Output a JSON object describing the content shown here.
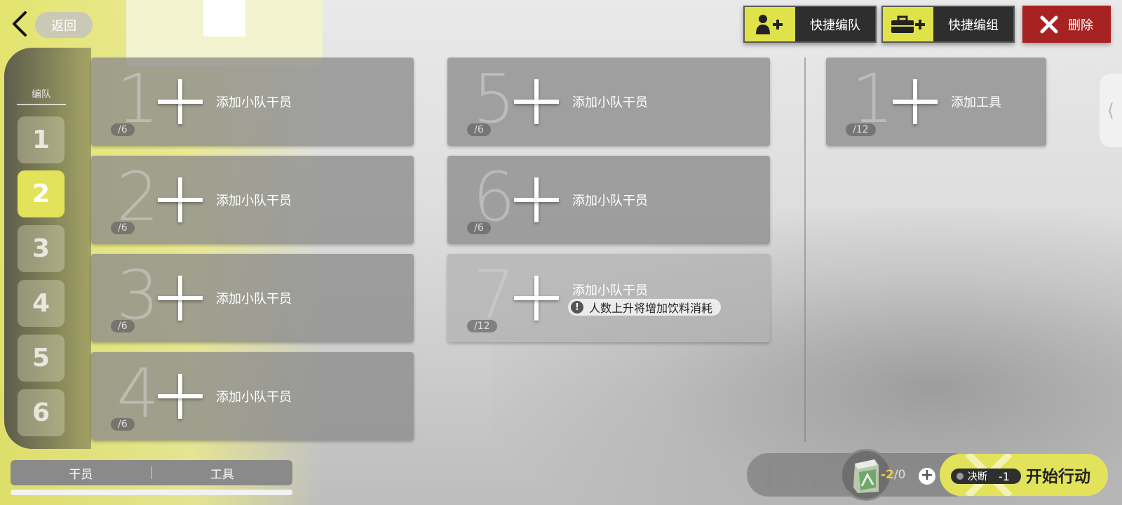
{
  "header": {
    "back_label": "返回"
  },
  "top_buttons": {
    "quick_team": "快捷编队",
    "quick_group": "快捷编组",
    "delete": "删除"
  },
  "squad_panel": {
    "title": "编队",
    "tabs": [
      "1",
      "2",
      "3",
      "4",
      "5",
      "6"
    ],
    "active": "2"
  },
  "slots": [
    {
      "num": "1",
      "cap": "/6",
      "label": "添加小队干员"
    },
    {
      "num": "2",
      "cap": "/6",
      "label": "添加小队干员"
    },
    {
      "num": "3",
      "cap": "/6",
      "label": "添加小队干员"
    },
    {
      "num": "4",
      "cap": "/6",
      "label": "添加小队干员"
    },
    {
      "num": "5",
      "cap": "/6",
      "label": "添加小队干员"
    },
    {
      "num": "6",
      "cap": "/6",
      "label": "添加小队干员"
    },
    {
      "num": "7",
      "cap": "/12",
      "label": "添加小队干员",
      "warning": "人数上升将增加饮料消耗"
    }
  ],
  "tool_slot": {
    "num": "1",
    "cap": "/12",
    "label": "添加工具"
  },
  "bottom_tabs": {
    "operators": "干员",
    "tools": "工具"
  },
  "resources": {
    "drink_value": "-2",
    "drink_max": "/0"
  },
  "start": {
    "decisive_label": "决断",
    "decisive_value": "-1",
    "label": "开始行动"
  },
  "colors": {
    "accent": "#e2e35a",
    "delete": "#a72222",
    "dark": "#2e2e2e"
  }
}
